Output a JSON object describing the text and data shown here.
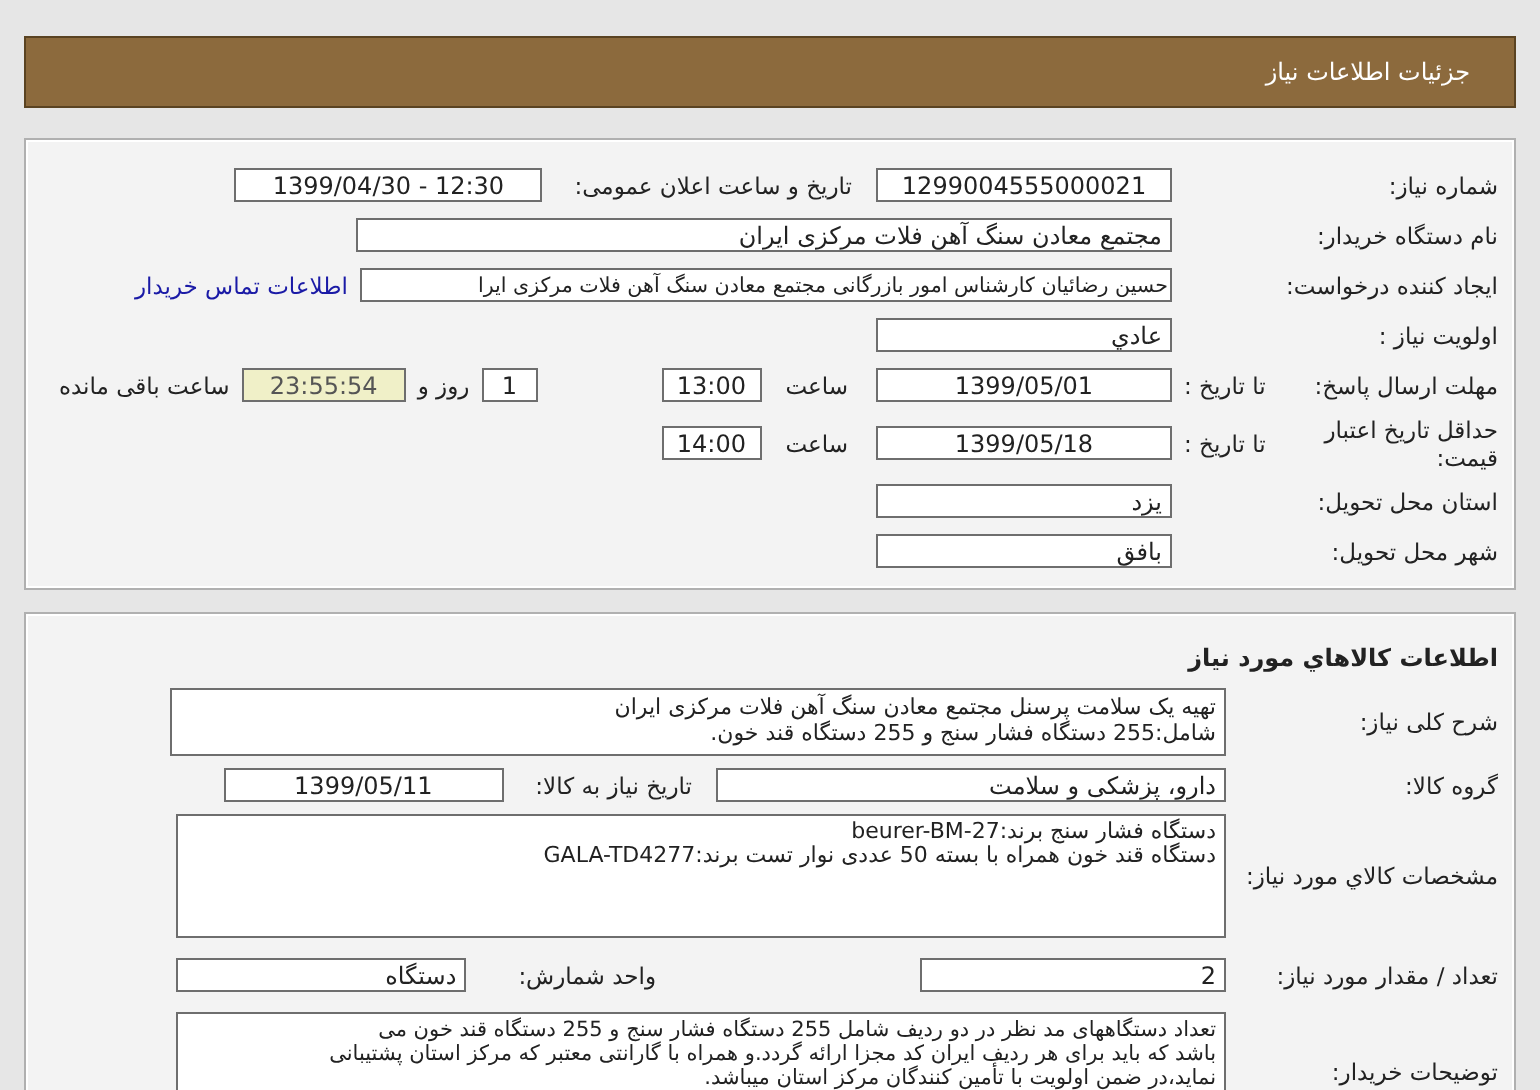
{
  "header": {
    "title": "جزئیات اطلاعات نیاز"
  },
  "request": {
    "need_number": {
      "label": "شماره نیاز:",
      "value": "1299004555000021"
    },
    "announce": {
      "label": "تاریخ و ساعت اعلان عمومی:",
      "value": "1399/04/30 - 12:30"
    },
    "buyer": {
      "label": "نام دستگاه خریدار:",
      "value": "مجتمع معادن سنگ آهن فلات مرکزی ایران"
    },
    "creator": {
      "label": "ایجاد کننده درخواست:",
      "value": "حسین رضائیان کارشناس امور بازرگانی مجتمع معادن سنگ آهن فلات مرکزی ایرا",
      "link": "اطلاعات تماس خریدار"
    },
    "priority": {
      "label": "اولویت نیاز :",
      "value": "عادي"
    },
    "deadline": {
      "label": "مهلت ارسال پاسخ:",
      "to_label": "تا تاریخ :",
      "date": "1399/05/01",
      "time_label": "ساعت",
      "time": "13:00",
      "days": "1",
      "days_label": "روز و",
      "remaining": "23:55:54",
      "remaining_label": "ساعت باقی مانده"
    },
    "validity": {
      "label": "حداقل تاریخ اعتبار قیمت:",
      "to_label": "تا تاریخ :",
      "date": "1399/05/18",
      "time_label": "ساعت",
      "time": "14:00"
    },
    "province": {
      "label": "استان محل تحویل:",
      "value": "یزد"
    },
    "city": {
      "label": "شهر محل تحویل:",
      "value": "بافق"
    }
  },
  "goods": {
    "title": "اطلاعات کالاهاي مورد نیاز",
    "description": {
      "label": "شرح کلی نیاز:",
      "lines": [
        "تهیه یک سلامت پرسنل مجتمع معادن سنگ آهن فلات مرکزی ایران",
        "شامل:255 دستگاه فشار سنج و 255 دستگاه قند خون."
      ]
    },
    "group": {
      "label": "گروه کالا:",
      "value": "دارو، پزشکی و سلامت",
      "need_date_label": "تاریخ نیاز به کالا:",
      "need_date": "1399/05/11"
    },
    "specs": {
      "label": "مشخصات کالاي مورد نیاز:",
      "lines": [
        "دستگاه فشار سنج برند:beurer-BM-27",
        "دستگاه قند خون همراه با بسته 50 عددی نوار تست برند:GALA-TD4277"
      ]
    },
    "quantity": {
      "label": "تعداد / مقدار مورد نیاز:",
      "value": "2",
      "unit_label": "واحد شمارش:",
      "unit": "دستگاه"
    },
    "notes": {
      "label": "توضیحات خریدار:",
      "lines": [
        "تعداد دستگاههای مد نظر در دو ردیف شامل 255 دستگاه فشار سنج و 255 دستگاه قند خون می",
        "باشد که باید برای هر ردیف ایران کد مجزا ارائه گردد.و همراه با گارانتی معتبر که مرکز استان پشتیبانی",
        "نماید،در ضمن اولویت با تأمین کنندگان مرکز استان میباشد."
      ]
    }
  }
}
